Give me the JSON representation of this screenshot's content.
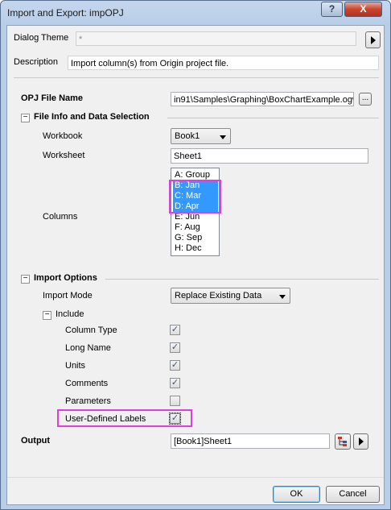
{
  "window": {
    "title": "Import and Export: impOPJ",
    "help_label": "?",
    "close_label": "X"
  },
  "theme": {
    "label": "Dialog Theme",
    "value": "*"
  },
  "description": {
    "label": "Description",
    "value": "Import column(s) from Origin project file."
  },
  "opj": {
    "label": "OPJ File Name",
    "value": "in91\\Samples\\Graphing\\BoxChartExample.ogw",
    "browse_label": "..."
  },
  "file_info": {
    "header": "File Info and Data Selection",
    "toggle": "−",
    "workbook_label": "Workbook",
    "workbook_value": "Book1",
    "worksheet_label": "Worksheet",
    "worksheet_value": "Sheet1",
    "columns_label": "Columns",
    "columns": [
      {
        "label": "A: Group",
        "selected": false
      },
      {
        "label": "B: Jan",
        "selected": true
      },
      {
        "label": "C: Mar",
        "selected": true
      },
      {
        "label": "D: Apr",
        "selected": true
      },
      {
        "label": "E: Jun",
        "selected": false
      },
      {
        "label": "F: Aug",
        "selected": false
      },
      {
        "label": "G: Sep",
        "selected": false
      },
      {
        "label": "H: Dec",
        "selected": false
      }
    ]
  },
  "import_options": {
    "header": "Import Options",
    "toggle": "−",
    "mode_label": "Import Mode",
    "mode_value": "Replace Existing Data",
    "include_label": "Include",
    "include_toggle": "−",
    "include_items": [
      {
        "label": "Column Type",
        "checked": true
      },
      {
        "label": "Long Name",
        "checked": true
      },
      {
        "label": "Units",
        "checked": true
      },
      {
        "label": "Comments",
        "checked": true
      },
      {
        "label": "Parameters",
        "checked": false
      },
      {
        "label": "User-Defined Labels",
        "checked": true
      }
    ]
  },
  "output": {
    "label": "Output",
    "value": "[Book1]Sheet1"
  },
  "buttons": {
    "ok": "OK",
    "cancel": "Cancel"
  },
  "colors": {
    "selection": "#3399ff",
    "highlight": "#e23ce0"
  }
}
